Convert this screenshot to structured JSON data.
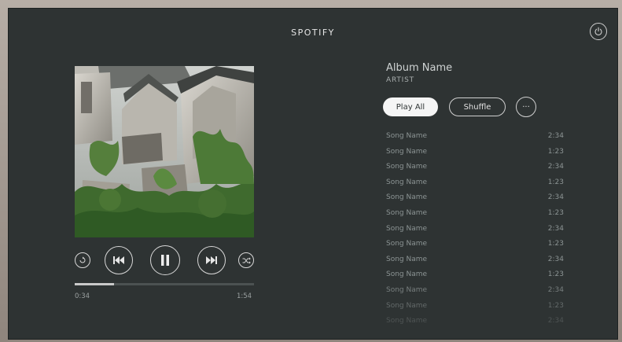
{
  "app": {
    "title": "SPOTIFY"
  },
  "album": {
    "name": "Album Name",
    "artist": "ARTIST"
  },
  "actions": {
    "play_all": "Play All",
    "shuffle": "Shuffle",
    "more": "···"
  },
  "player": {
    "elapsed": "0:34",
    "total": "1:54",
    "progress_fraction": 0.22,
    "controls": [
      "repeat-icon",
      "previous-icon",
      "pause-icon",
      "next-icon",
      "shuffle-icon"
    ]
  },
  "tracks": [
    {
      "name": "Song Name",
      "duration": "2:34"
    },
    {
      "name": "Song Name",
      "duration": "1:23"
    },
    {
      "name": "Song Name",
      "duration": "2:34"
    },
    {
      "name": "Song Name",
      "duration": "1:23"
    },
    {
      "name": "Song Name",
      "duration": "2:34"
    },
    {
      "name": "Song Name",
      "duration": "1:23"
    },
    {
      "name": "Song Name",
      "duration": "2:34"
    },
    {
      "name": "Song Name",
      "duration": "1:23"
    },
    {
      "name": "Song Name",
      "duration": "2:34"
    },
    {
      "name": "Song Name",
      "duration": "1:23"
    },
    {
      "name": "Song Name",
      "duration": "2:34"
    },
    {
      "name": "Song Name",
      "duration": "1:23"
    },
    {
      "name": "Song Name",
      "duration": "2:34"
    }
  ],
  "colors": {
    "background": "#2e3333",
    "accent": "#f5f5f5",
    "text_muted": "#8c9494"
  }
}
